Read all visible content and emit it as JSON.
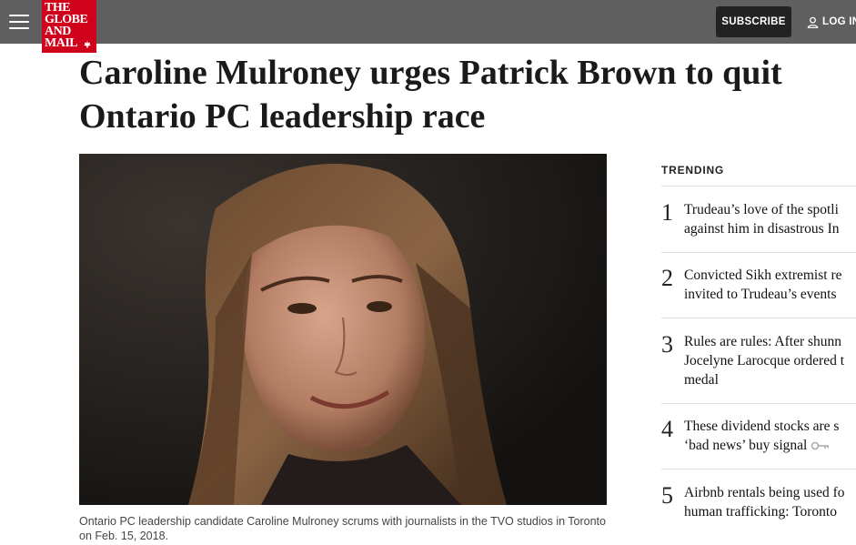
{
  "header": {
    "logo_lines": [
      "THE",
      "GLOBE",
      "AND",
      "MAIL"
    ],
    "subscribe_label": "SUBSCRIBE",
    "login_label": "LOG IN",
    "accent_color": "#d0021b",
    "bar_color": "#5f5f5f"
  },
  "article": {
    "headline": "Caroline Mulroney urges Patrick Brown to quit Ontario PC leadership race",
    "caption": "Ontario PC leadership candidate Caroline Mulroney scrums with journalists in the TVO studios in Toronto on Feb. 15, 2018."
  },
  "trending": {
    "title": "TRENDING",
    "items": [
      {
        "number": "1",
        "lines": [
          "Trudeau’s love of the spotli",
          "against him in disastrous In"
        ]
      },
      {
        "number": "2",
        "lines": [
          "Convicted Sikh extremist re",
          "invited to Trudeau’s events"
        ]
      },
      {
        "number": "3",
        "lines": [
          "Rules are rules: After shunn",
          "Jocelyne Larocque ordered t",
          "medal"
        ]
      },
      {
        "number": "4",
        "lines": [
          "These dividend stocks are s",
          "‘bad news’ buy signal"
        ],
        "icon": "key-icon"
      },
      {
        "number": "5",
        "lines": [
          "Airbnb rentals being used fo",
          "human trafficking: Toronto"
        ]
      }
    ]
  }
}
